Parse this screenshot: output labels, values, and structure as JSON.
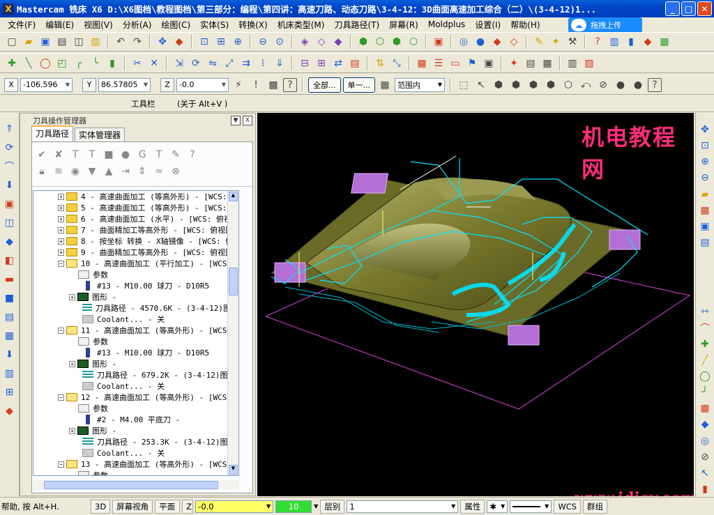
{
  "window": {
    "title": "Mastercam 铣床 X6   D:\\X6图档\\教程图档\\第三部分：编程\\第四讲：高速刀路、动态刀路\\3-4-12：3D曲面高速加工综合（二）\\(3-4-12)1...",
    "app_glyph": "X",
    "minimize_glyph": "_",
    "maximize_glyph": "□",
    "close_glyph": "✕"
  },
  "menu": [
    "文件(F)",
    "编辑(E)",
    "视图(V)",
    "分析(A)",
    "绘图(C)",
    "实体(S)",
    "转换(X)",
    "机床类型(M)",
    "刀具路径(T)",
    "屏幕(R)",
    "Moldplus",
    "设置(I)",
    "帮助(H)"
  ],
  "upload_button": "拖拽上传",
  "coords": {
    "x_label": "X",
    "x_value": "-106.596",
    "y_label": "Y",
    "y_value": "86.57805",
    "z_label": "Z",
    "z_value": "-0.0",
    "all_button": "全部...",
    "single_button": "单一...",
    "range_value": "范围内"
  },
  "caption": {
    "toolbar_label": "工具栏",
    "about_label": "(关于  Alt+V )"
  },
  "ops": {
    "header": "刀具操作管理器",
    "pin_glyph": "▼",
    "close_glyph": "X",
    "tab_toolpaths": "刀具路径",
    "tab_solids": "实体管理器",
    "tree": [
      {
        "kind": "op",
        "label": "4 - 高速曲面加工 (等高外形) - [WCS:"
      },
      {
        "kind": "op",
        "label": "5 - 高速曲面加工 (等高外形) - [WCS:"
      },
      {
        "kind": "op",
        "label": "6 - 高速曲面加工 (水平) - [WCS: 俯视"
      },
      {
        "kind": "op",
        "label": "7 - 曲面精加工等高外形 - [WCS: 俯视图"
      },
      {
        "kind": "op",
        "label": "8 - 按坐标 转换 - X轴镜像 - [WCS: 俯"
      },
      {
        "kind": "op",
        "label": "9 - 曲面精加工等高外形 - [WCS: 俯视图"
      },
      {
        "kind": "op-open",
        "label": "10 - 高速曲面加工 (平行加工) - [WCS"
      },
      {
        "kind": "param",
        "label": "参数"
      },
      {
        "kind": "tool",
        "label": "#13 - M10.00 球刀 - D10R5"
      },
      {
        "kind": "geo",
        "label": "图形 -"
      },
      {
        "kind": "path",
        "label": "刀具路径 - 4570.6K - (3-4-12)图档"
      },
      {
        "kind": "cool",
        "label": "Coolant... - 关"
      },
      {
        "kind": "op-open",
        "label": "11 - 高速曲面加工 (等高外形) - [WCS"
      },
      {
        "kind": "param",
        "label": "参数"
      },
      {
        "kind": "tool",
        "label": "#13 - M10.00 球刀 - D10R5"
      },
      {
        "kind": "geo",
        "label": "图形 -"
      },
      {
        "kind": "path",
        "label": "刀具路径 - 679.2K - (3-4-12)图档"
      },
      {
        "kind": "cool",
        "label": "Coolant... - 关"
      },
      {
        "kind": "op-open",
        "label": "12 - 高速曲面加工 (等高外形) - [WCS"
      },
      {
        "kind": "param",
        "label": "参数"
      },
      {
        "kind": "tool",
        "label": "#2 - M4.00 平底刀 -"
      },
      {
        "kind": "geo",
        "label": "图形 -"
      },
      {
        "kind": "path",
        "label": "刀具路径 - 253.3K - (3-4-12)图档"
      },
      {
        "kind": "cool",
        "label": "Coolant... - 关"
      },
      {
        "kind": "op-open",
        "label": "13 - 高速曲面加工 (等高外形) - [WCS"
      },
      {
        "kind": "param",
        "label": "参数"
      }
    ]
  },
  "watermark": {
    "cn": "机电教程网",
    "url": "www.jdjcy.com"
  },
  "status": {
    "help": "帮助, 按 Alt+H.",
    "mode_3d": "3D",
    "screen_view": "屏幕视角",
    "plane": "平面",
    "z_label": "Z",
    "z_value": "-0.0",
    "level_value": "10",
    "layer_label": "层别",
    "layer_value": "1",
    "attr_button": "属性",
    "wcs_label": "WCS",
    "group_label": "群组"
  },
  "colors": {
    "title_bar": "#0046c8",
    "viewport_bg": "#000000",
    "toolpath": "#00e5ff",
    "part_surface": "#8a8a3a",
    "boundary": "#e040e0",
    "watermark": "#ff2d7a",
    "z_field_bg": "#ffff66",
    "level_field_bg": "#33dd33"
  }
}
